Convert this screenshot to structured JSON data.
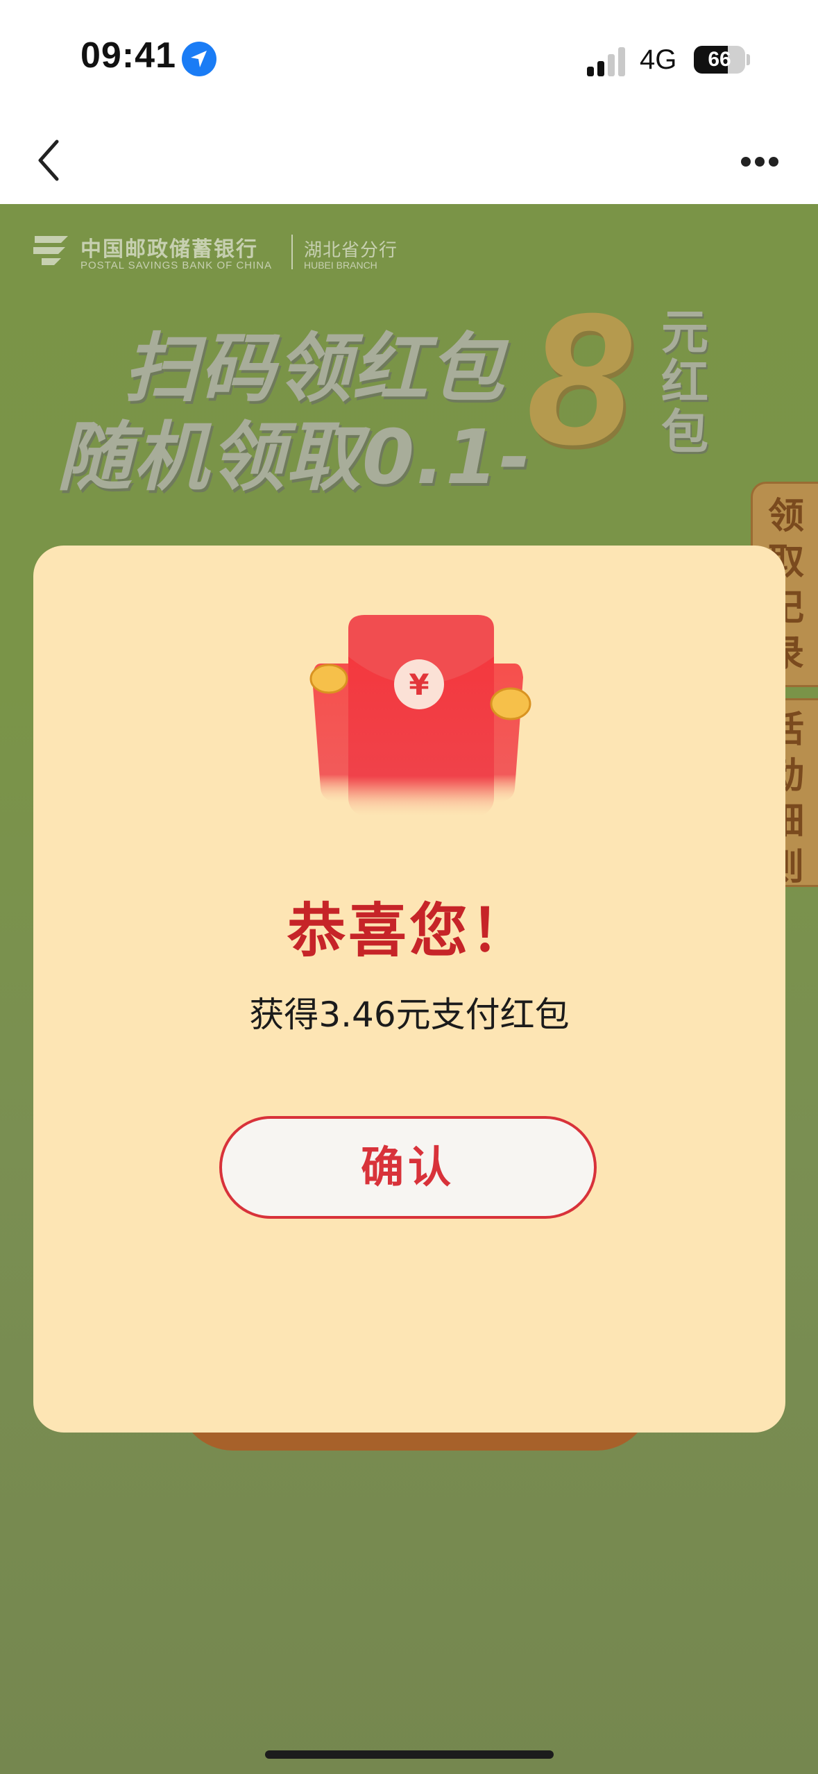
{
  "status_bar": {
    "time": "09:41",
    "network": "4G",
    "battery": "66",
    "battery_level_percent": 66,
    "icons": [
      "location-arrow-icon",
      "signal-icon",
      "battery-icon"
    ]
  },
  "nav": {
    "back_icon": "chevron-left-icon",
    "more_icon": "more-dots-icon"
  },
  "banner": {
    "bank_name": "中国邮政储蓄银行",
    "bank_name_en": "POSTAL SAVINGS BANK OF CHINA",
    "branch_name": "湖北省分行",
    "branch_name_en": "HUBEI BRANCH",
    "headline_line1": "扫码领红包",
    "headline_line2": "随机领取0.1-",
    "big_number": "8",
    "unit_line": "元红包",
    "unit_chars": [
      "元",
      "红",
      "包"
    ]
  },
  "side_tabs": {
    "record": "领取记录",
    "record_chars": [
      "领",
      "取",
      "记",
      "录"
    ],
    "rules": "活动细则",
    "rules_chars": [
      "活",
      "动",
      "细",
      "则"
    ]
  },
  "modal": {
    "envelope_icon": "red-envelope-icon",
    "envelope_symbol": "¥",
    "title": "恭喜您！",
    "message": "获得3.46元支付红包",
    "confirm_label": "确认"
  },
  "colors": {
    "background_green": "#7a9447",
    "modal_bg": "#fde5b4",
    "accent_red": "#d8323a",
    "title_red": "#c62428"
  }
}
